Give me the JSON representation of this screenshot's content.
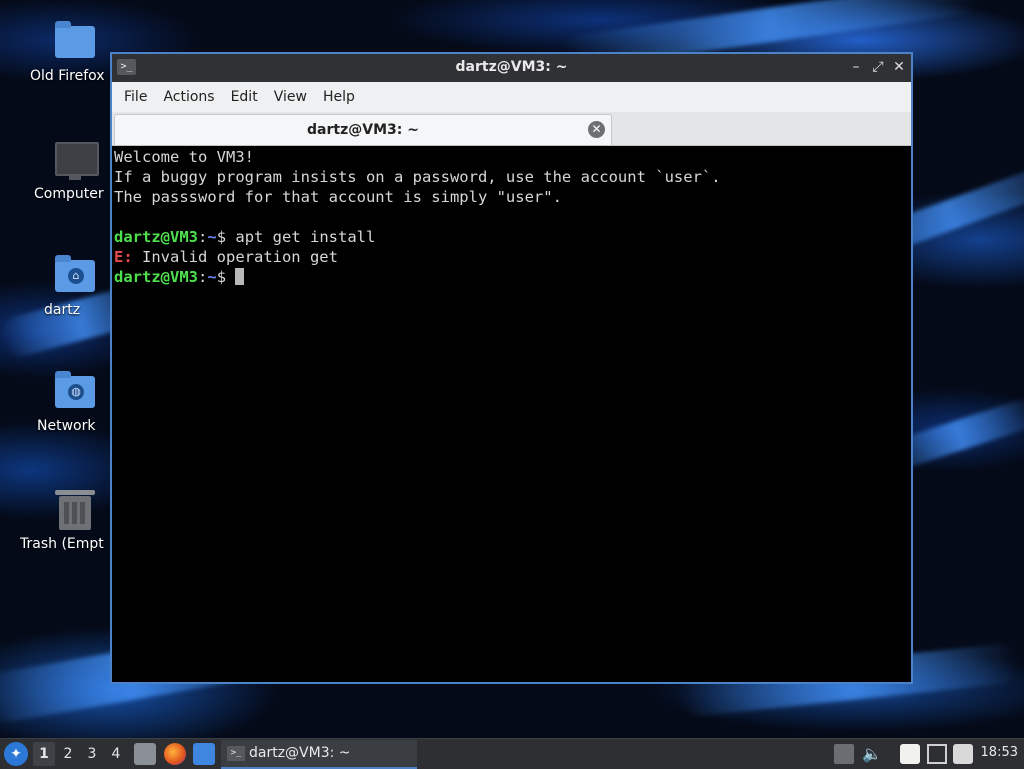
{
  "desktop": {
    "icons": [
      {
        "label": "Old Firefox D",
        "icon": "folder-icon"
      },
      {
        "label": "Computer",
        "icon": "computer-icon"
      },
      {
        "label": "dartz",
        "icon": "home-folder-icon"
      },
      {
        "label": "Network",
        "icon": "network-folder-icon"
      },
      {
        "label": "Trash (Empt",
        "icon": "trash-icon"
      }
    ]
  },
  "window": {
    "title": "dartz@VM3: ~",
    "buttons": {
      "minimize": "–",
      "maximize": "⤢",
      "close": "✕"
    },
    "menu": [
      "File",
      "Actions",
      "Edit",
      "View",
      "Help"
    ],
    "tab": {
      "label": "dartz@VM3: ~",
      "close": "✕"
    }
  },
  "terminal": {
    "welcome": [
      "Welcome to VM3!",
      "If a buggy program insists on a password, use the account `user`.",
      "The passsword for that account is simply \"user\"."
    ],
    "prompt_user": "dartz@VM3",
    "prompt_sep": ":",
    "prompt_path": "~",
    "prompt_sym": "$ ",
    "command": "apt get install",
    "error_tag": "E:",
    "error_msg": " Invalid operation get"
  },
  "taskbar": {
    "workspaces": [
      "1",
      "2",
      "3",
      "4"
    ],
    "active_workspace": "1",
    "task_label": "dartz@VM3: ~",
    "clock": "18:53"
  },
  "colors": {
    "prompt_user": "#4ee04e",
    "prompt_path": "#6a84f0",
    "error": "#e84a4a",
    "accent": "#4c82c8"
  }
}
